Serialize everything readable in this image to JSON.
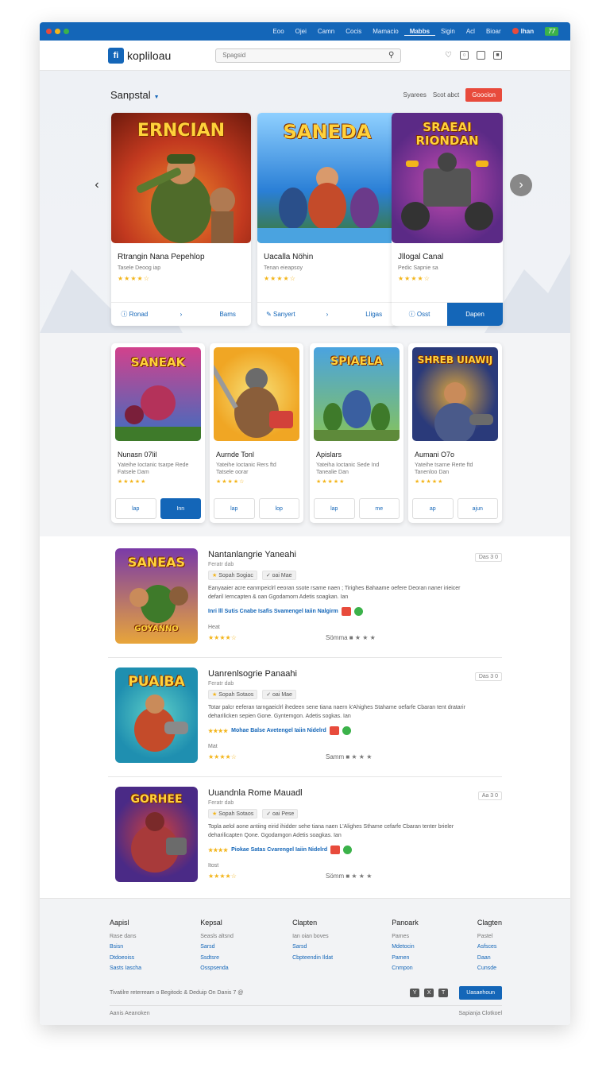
{
  "topnav": {
    "items": [
      "Eoo",
      "Ojei",
      "Camn",
      "Cocis",
      "Mamacio",
      "Mabbs",
      "Sigin",
      "Acl",
      "Bioar"
    ],
    "active_index": 5,
    "user": "Ihan",
    "badge": "77"
  },
  "header": {
    "logo_text": "kopliloau",
    "logo_mark": "fi",
    "search_placeholder": "Spagsid"
  },
  "section": {
    "title": "Sanpstal",
    "link1": "Syarees",
    "link2": "Scot abct",
    "button": "Goocion"
  },
  "featured": [
    {
      "art_title": "ERNCIAN",
      "title": "Rtrangin Nana Pepehlop",
      "sub": "Tasele Deoog iap",
      "stars": "★★★★☆",
      "a1": "Ronad",
      "a2": "Bams",
      "colors": [
        "#c2391f",
        "#f08a2a"
      ]
    },
    {
      "art_title": "SANEDA",
      "title": "Uacalla Nöhin",
      "sub": "Tenan eieapsoy",
      "stars": "★★★★☆",
      "a1": "Sanyert",
      "a2": "Lligas",
      "colors": [
        "#2a7fd6",
        "#8fd0ff"
      ]
    },
    {
      "art_title": "SRAEAI RIONDAN",
      "title": "Jllogal Canal",
      "sub": "Pedic Sapnie sa",
      "stars": "★★★★☆",
      "a1": "Osst",
      "a2": "Dapen",
      "colors": [
        "#5b2a86",
        "#c44bb0"
      ]
    }
  ],
  "games": [
    {
      "art_title": "SANEAK",
      "title": "Nunasn 07lil",
      "sub1": "Yateihe Ioctanic tsarpe Rede",
      "sub2": "Fatsele Dam",
      "stars": "★★★★★",
      "b1": "lap",
      "b2": "Inn",
      "colors": [
        "#3a6fc2",
        "#d2418c"
      ]
    },
    {
      "art_title": "",
      "title": "Aurnde Tonl",
      "sub1": "Yateihe Ioctanic Rers ftd",
      "sub2": "Tatsele oorar",
      "stars": "★★★★☆",
      "b1": "lap",
      "b2": "lop",
      "colors": [
        "#f0a624",
        "#f7e27a"
      ]
    },
    {
      "art_title": "SPIAELA",
      "title": "Apislars",
      "sub1": "Yateiha Ioctanic Sede Ind",
      "sub2": "Tanealie Dan",
      "stars": "★★★★★",
      "b1": "lap",
      "b2": "me",
      "colors": [
        "#4aa3e0",
        "#86c35a"
      ]
    },
    {
      "art_title": "SHREB UIAWIJ",
      "title": "Aumani O7o",
      "sub1": "Yateihe tsarne Rerte ftd",
      "sub2": "Tanenloo Dan",
      "stars": "★★★★★",
      "b1": "ap",
      "b2": "ajun",
      "colors": [
        "#2a3a7a",
        "#e2a83b"
      ]
    }
  ],
  "list": [
    {
      "art_title": "SANEAS",
      "art_sub": "GOYANNO",
      "name": "Nantanlangrie Yaneahi",
      "dev": "Feratr dab",
      "tag1": "Sopah Sogiac",
      "tag2": "oai Mae",
      "desc": "Eanyaaier acre eanmpeiclrl eeoran ssote rsame naen ; Tirighes Bahaame oefere Deoran naner irieicer defaril Ierncapten & oan Ggodamorn Adetis soagkan. Ian",
      "links": "Inri lll Sutis Cnabe Isafis Svamengel Iaiin Nalgirm",
      "meta": "Heat",
      "stars": "★★★★☆",
      "score": "Sömma",
      "badge": "Das 3 0",
      "colors": [
        "#7a3aa8",
        "#e8a53a"
      ]
    },
    {
      "art_title": "PUAIBA",
      "art_sub": "",
      "name": "Uanrenlsogrie Panaahi",
      "dev": "Feratr dab",
      "tag1": "Sopah Sotaos",
      "tag2": "oai Mae",
      "desc": "Totar palcr eeferan tarngaeiclrl ihedeen sene tiana naern k'Ahighes Stahame oefarfe Cbaran tent dratarir deharilicken sepien Gone. Gyntemgon. Adetis sogkas. Ian",
      "links": "Mohae Balse Avetengel Iaiin Nidelrd",
      "meta": "Mat",
      "stars": "★★★★☆",
      "score": "Samm",
      "badge": "Das 3 0",
      "colors": [
        "#1f8fb0",
        "#5fd0c8"
      ]
    },
    {
      "art_title": "GORHEE",
      "art_sub": "",
      "name": "Uuandnla Rome Mauadl",
      "dev": "Feratr dab",
      "tag1": "Sopah Sotaos",
      "tag2": "oai Pese",
      "desc": "Topla aelol aone antiing eirid ihidder sehe tiana naen L'Alighes Sthame cefarfe Cbaran tenter brieler deharilicapten Qone. Ggodamgon Adetis soagkas. Ian",
      "links": "Piokae Satas Cvarengel Iaiin Nidelrd",
      "meta": "Itost",
      "stars": "★★★★☆",
      "score": "Sömm",
      "badge": "Aa 3 0",
      "colors": [
        "#4a2a86",
        "#d2413a"
      ]
    }
  ],
  "footer": {
    "columns": [
      {
        "heading": "Aapisl",
        "plain": [
          "Rase dans"
        ],
        "links": [
          "Bsisn",
          "Dtdoeoiss",
          "Sasts Iascha"
        ]
      },
      {
        "heading": "Kepsal",
        "plain": [
          "Seasls altsnd"
        ],
        "links": [
          "Sarsd",
          "Ssdtsre",
          "Osspsenda"
        ]
      },
      {
        "heading": "Clapten",
        "plain": [
          "Ian oian boves"
        ],
        "links": [
          "Sarsd",
          "Cbpteendin Ildat"
        ]
      },
      {
        "heading": "Panoark",
        "plain": [
          "Pames"
        ],
        "links": [
          "Mdetocin",
          "Pamen",
          "Cnmpon"
        ]
      },
      {
        "heading": "Clagten",
        "plain": [
          "Pastel"
        ],
        "links": [
          "Asfsces",
          "Daan",
          "Cunsde"
        ]
      }
    ],
    "note": "Tivatilre reterream o Begitodc & Deduip On Danis 7 @",
    "subscribe": "Uasaehoun",
    "copy_left": "Aanis Aeanoken",
    "copy_right": "Sapianja Clotkoel"
  }
}
